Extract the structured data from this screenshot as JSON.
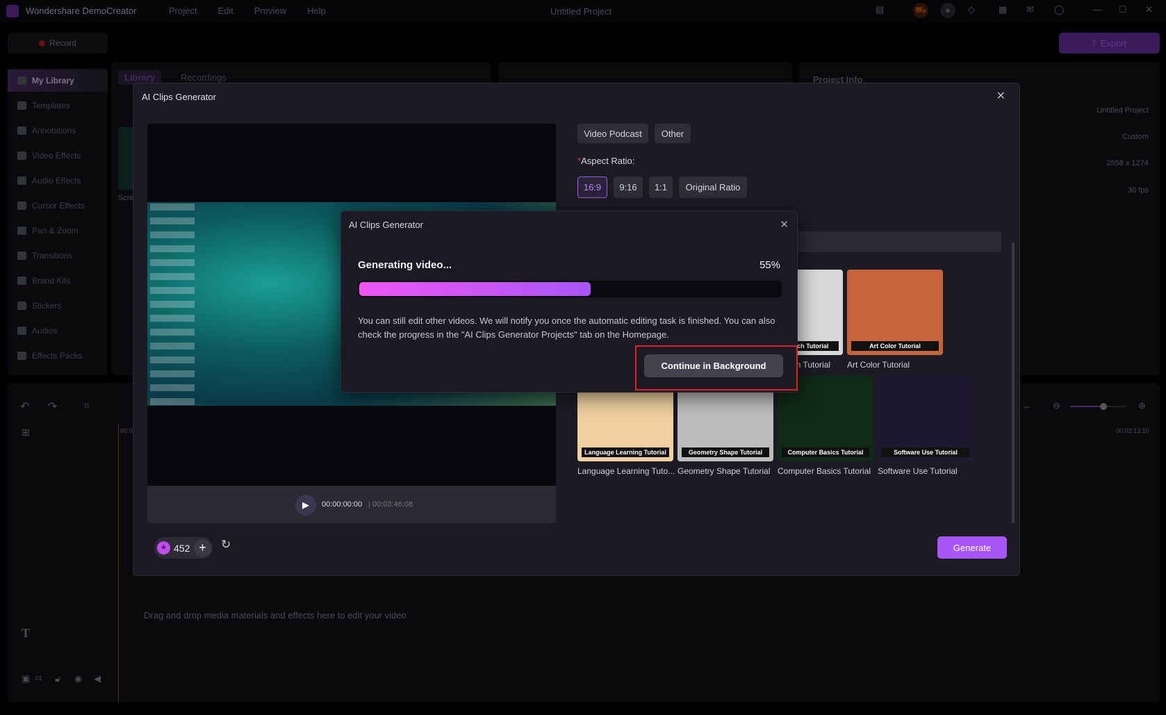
{
  "app": {
    "name": "Wondershare DemoCreator",
    "project_title": "Untitled Project",
    "menu": [
      "Project",
      "Edit",
      "Preview",
      "Help"
    ]
  },
  "toolbar": {
    "record_label": "Record",
    "export_label": "Export"
  },
  "sidebar": {
    "items": [
      {
        "label": "My Library",
        "icon": "layers-icon",
        "active": true
      },
      {
        "label": "Templates",
        "icon": "template-icon"
      },
      {
        "label": "Annotations",
        "icon": "annotation-icon"
      },
      {
        "label": "Video Effects",
        "icon": "video-effects-icon"
      },
      {
        "label": "Audio Effects",
        "icon": "audio-effects-icon"
      },
      {
        "label": "Cursor Effects",
        "icon": "cursor-icon"
      },
      {
        "label": "Pan & Zoom",
        "icon": "pan-zoom-icon"
      },
      {
        "label": "Transitions",
        "icon": "transitions-icon"
      },
      {
        "label": "Brand Kits",
        "icon": "brand-icon"
      },
      {
        "label": "Stickers",
        "icon": "sticker-icon"
      },
      {
        "label": "Audios",
        "icon": "music-icon"
      },
      {
        "label": "Effects Packs",
        "icon": "pack-icon"
      }
    ]
  },
  "library": {
    "tabs": [
      "Library",
      "Recordings"
    ],
    "clip_label": "Scre"
  },
  "project_info": {
    "title": "Project Info",
    "values": [
      "Untitled Project",
      "Custom",
      "2558 x 1274",
      "30 fps"
    ]
  },
  "timeline": {
    "time_start": "00:0",
    "time_end": "00:02:13:10",
    "empty_hint": "Drag and drop media materials and effects here to edit your video",
    "track_label": "01",
    "zoom_level": 0.6
  },
  "modal": {
    "title": "AI Clips Generator",
    "player": {
      "current": "00:00:00:00",
      "total": "00:03:46:08"
    },
    "categories": [
      "Video Podcast",
      "Other"
    ],
    "aspect_label": "Aspect Ratio:",
    "aspect_required": "*",
    "aspect_options": [
      "16:9",
      "9:16",
      "1:1",
      "Original Ratio"
    ],
    "aspect_selected": "16:9",
    "templates": [
      {
        "label": "Design Sketch Tutorial",
        "caption": "Design Sketch Tutorial",
        "color": "#d8d8d8"
      },
      {
        "label": "Art Color Tutorial",
        "caption": "Art Color Tutorial",
        "color": "#c8643c"
      },
      {
        "label": "Language Learning Tuto...",
        "caption": "Language Learning Tutorial",
        "color": "#f0d0a0"
      },
      {
        "label": "Geometry Shape Tutorial",
        "caption": "Geometry Shape Tutorial",
        "color": "#bdbdbd"
      },
      {
        "label": "Computer Basics Tutorial",
        "caption": "Computer Basics Tutorial",
        "color": "#0f2a18"
      },
      {
        "label": "Software Use Tutorial",
        "caption": "Software Use Tutorial",
        "color": "#1e1830"
      }
    ],
    "credits": "452",
    "generate_label": "Generate"
  },
  "progress_dialog": {
    "title": "AI Clips Generator",
    "status": "Generating video...",
    "percent_label": "55%",
    "percent": 55,
    "message": "You can still edit other videos. We will notify you once the automatic editing task is finished. You can also check the progress in the \"AI Clips Generator Projects\" tab on the Homepage.",
    "button_label": "Continue in Background"
  },
  "colors": {
    "accent": "#a855f7",
    "progress_start": "#f055f5",
    "progress_end": "#a855f7",
    "highlight": "#e0202a"
  }
}
